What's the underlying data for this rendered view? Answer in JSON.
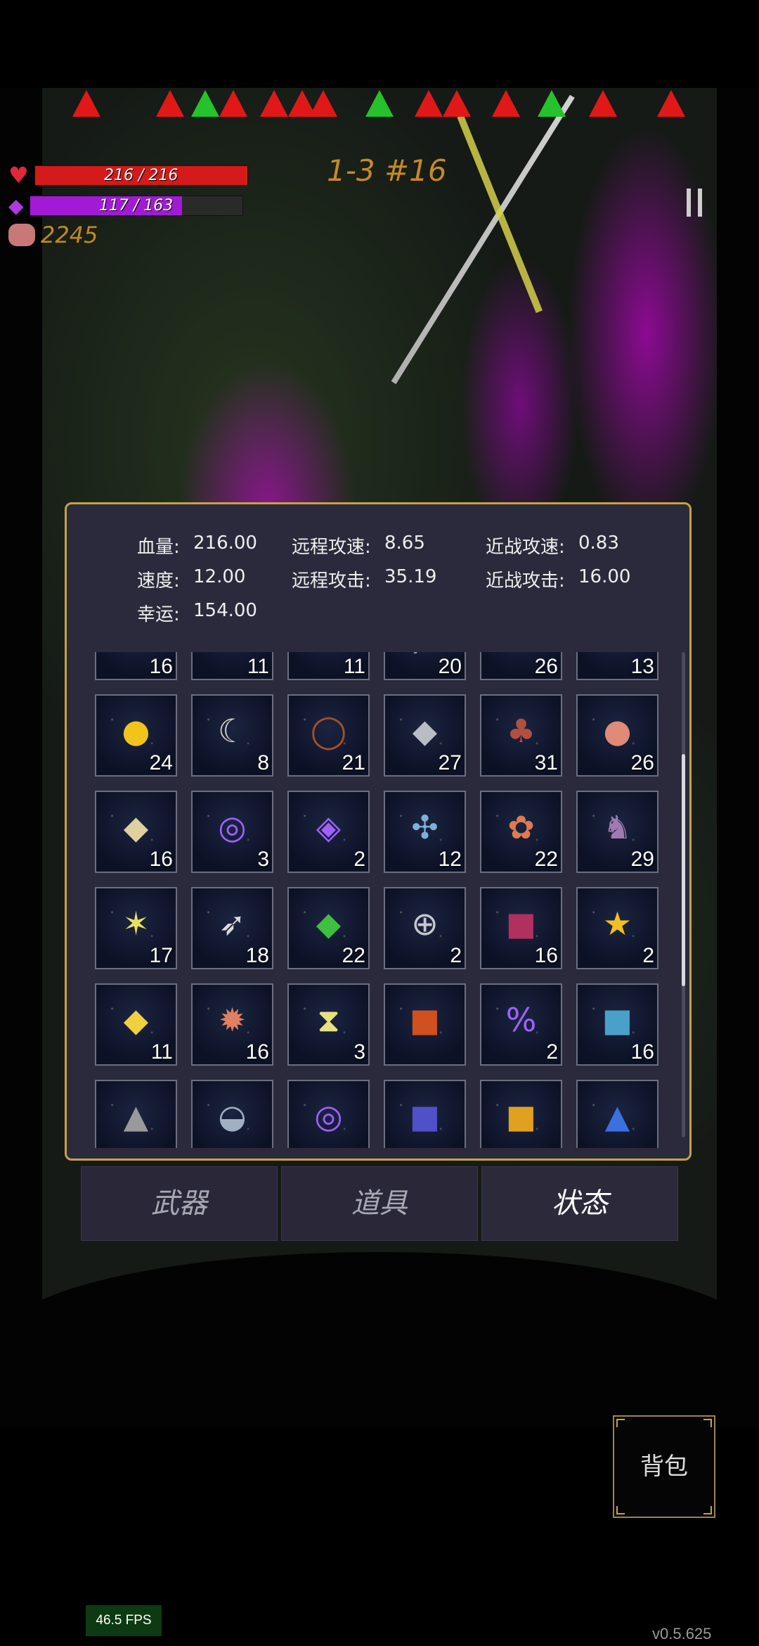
{
  "hud": {
    "hp_text": "216 / 216",
    "hp_fraction": 1.0,
    "mp_text": "117 / 163",
    "mp_fraction": 0.718,
    "gold": "2245",
    "level": "1-3 #16"
  },
  "colors": {
    "hp": "#d41a1a",
    "mp": "#a21ad6",
    "gold": "#c08a1e",
    "panel_border": "#c8a143"
  },
  "stats": [
    {
      "label": "血量:",
      "value": "216.00"
    },
    {
      "label": "远程攻速:",
      "value": "8.65"
    },
    {
      "label": "近战攻速:",
      "value": "0.83"
    },
    {
      "label": "速度:",
      "value": "12.00"
    },
    {
      "label": "远程攻击:",
      "value": "35.19"
    },
    {
      "label": "近战攻击:",
      "value": "16.00"
    },
    {
      "label": "幸运:",
      "value": "154.00"
    }
  ],
  "items": [
    {
      "icon": "green-potion-icon",
      "glyph": "⚗",
      "color": "#33e050",
      "count": "16"
    },
    {
      "icon": "seed-pouch-icon",
      "glyph": "●",
      "color": "#b89a70",
      "count": "11"
    },
    {
      "icon": "mushroom-icon",
      "glyph": "♠",
      "color": "#d08a80",
      "count": "11"
    },
    {
      "icon": "vial-icon",
      "glyph": "╱",
      "color": "#7aa6c8",
      "count": "20"
    },
    {
      "icon": "worm-icon",
      "glyph": "∿",
      "color": "#e6a0d8",
      "count": "26"
    },
    {
      "icon": "skull-book-icon",
      "glyph": "■",
      "color": "#3f7a38",
      "count": "13"
    },
    {
      "icon": "sun-orb-icon",
      "glyph": "●",
      "color": "#f1c41c",
      "count": "24"
    },
    {
      "icon": "fang-icon",
      "glyph": "☾",
      "color": "#ddd4c4",
      "count": "8"
    },
    {
      "icon": "thorn-ring-icon",
      "glyph": "◯",
      "color": "#a0502c",
      "count": "21"
    },
    {
      "icon": "stone-icon",
      "glyph": "◆",
      "color": "#b9bcc2",
      "count": "27"
    },
    {
      "icon": "meat-icon",
      "glyph": "♣",
      "color": "#b05040",
      "count": "31"
    },
    {
      "icon": "peach-icon",
      "glyph": "●",
      "color": "#e08a78",
      "count": "26"
    },
    {
      "icon": "gold-ore-icon",
      "glyph": "◆",
      "color": "#e0d0a0",
      "count": "16"
    },
    {
      "icon": "purple-spiral-rune-icon",
      "glyph": "◎",
      "color": "#a060ff",
      "count": "3"
    },
    {
      "icon": "purple-eye-rune-icon",
      "glyph": "◈",
      "color": "#a060ff",
      "count": "2"
    },
    {
      "icon": "dragonfly-icon",
      "glyph": "✣",
      "color": "#7fb0d8",
      "count": "12"
    },
    {
      "icon": "flowers-icon",
      "glyph": "✿",
      "color": "#e07a50",
      "count": "22"
    },
    {
      "icon": "boots-icon",
      "glyph": "♞",
      "color": "#a07ab0",
      "count": "29"
    },
    {
      "icon": "star-crystal-icon",
      "glyph": "✶",
      "color": "#e8e060",
      "count": "17"
    },
    {
      "icon": "feather-icon",
      "glyph": "➶",
      "color": "#dcdcdc",
      "count": "18"
    },
    {
      "icon": "emerald-icon",
      "glyph": "◆",
      "color": "#3fc040",
      "count": "22"
    },
    {
      "icon": "medic-ring-icon",
      "glyph": "⊕",
      "color": "#c8c8d0",
      "count": "2"
    },
    {
      "icon": "red-tome-icon",
      "glyph": "■",
      "color": "#b03060",
      "count": "16"
    },
    {
      "icon": "star-trophy-icon",
      "glyph": "★",
      "color": "#f0c020",
      "count": "2"
    },
    {
      "icon": "yellow-crystal-icon",
      "glyph": "◆",
      "color": "#f0d040",
      "count": "11"
    },
    {
      "icon": "spiky-mask-icon",
      "glyph": "✹",
      "color": "#e08060",
      "count": "16"
    },
    {
      "icon": "hourglass-card-icon",
      "glyph": "⧗",
      "color": "#e8e080",
      "count": "3"
    },
    {
      "icon": "fire-tome-icon",
      "glyph": "■",
      "color": "#d05020",
      "count": ""
    },
    {
      "icon": "percent-rune-icon",
      "glyph": "%",
      "color": "#a060ff",
      "count": "2"
    },
    {
      "icon": "blue-tome-icon",
      "glyph": "■",
      "color": "#4aa0c8",
      "count": "16"
    },
    {
      "icon": "tombstone-icon",
      "glyph": "▲",
      "color": "#9a9a9a",
      "count": ""
    },
    {
      "icon": "mask-icon",
      "glyph": "◒",
      "color": "#a0b0c0",
      "count": ""
    },
    {
      "icon": "spiral-rune-icon",
      "glyph": "◎",
      "color": "#a060ff",
      "count": ""
    },
    {
      "icon": "arrow-tome-icon",
      "glyph": "■",
      "color": "#5050c8",
      "count": ""
    },
    {
      "icon": "orange-tome-icon",
      "glyph": "■",
      "color": "#e0a020",
      "count": ""
    },
    {
      "icon": "blue-cone-icon",
      "glyph": "▲",
      "color": "#3a70e0",
      "count": ""
    }
  ],
  "tabs": {
    "weapons": "武器",
    "items": "道具",
    "status": "状态"
  },
  "bag_label": "背包",
  "fps": "46.5 FPS",
  "version": "v0.5.625"
}
